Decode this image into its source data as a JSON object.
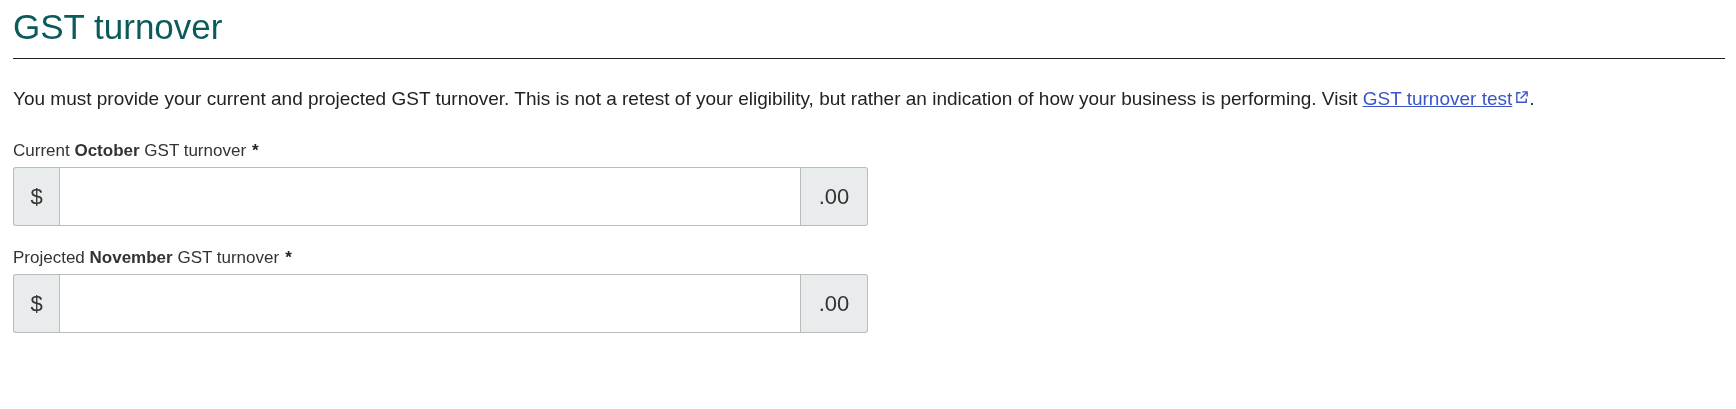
{
  "heading": "GST turnover",
  "intro": {
    "text": "You must provide your current and projected GST turnover. This is not a retest of your eligibility, but rather an indication of how your business is performing. Visit ",
    "link": "GST turnover test",
    "after": "."
  },
  "fields": [
    {
      "label": "Current **October** GST turnover",
      "required_mark": "*",
      "prefix": "$",
      "suffix": ".00"
    },
    {
      "label": "Projected **November** GST turnover",
      "required_mark": "*",
      "prefix": "$",
      "suffix": ".00"
    }
  ]
}
